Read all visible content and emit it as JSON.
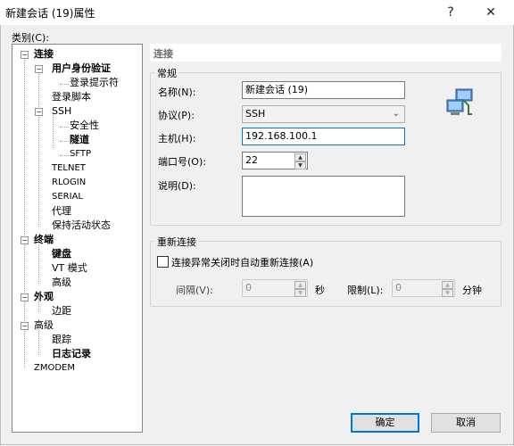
{
  "window": {
    "title": "新建会话 (19)属性",
    "help_glyph": "?",
    "close_glyph": "✕"
  },
  "category_label": "类别(C):",
  "tree": {
    "n0": "连接",
    "n1": "用户身份验证",
    "n2": "登录提示符",
    "n3": "登录脚本",
    "n4": "SSH",
    "n5": "安全性",
    "n6": "隧道",
    "n7": "SFTP",
    "n8": "TELNET",
    "n9": "RLOGIN",
    "n10": "SERIAL",
    "n11": "代理",
    "n12": "保持活动状态",
    "n13": "终端",
    "n14": "键盘",
    "n15": "VT 模式",
    "n16": "高级",
    "n17": "外观",
    "n18": "边距",
    "n19": "高级",
    "n20": "跟踪",
    "n21": "日志记录",
    "n22": "ZMODEM"
  },
  "section_title": "连接",
  "general": {
    "title": "常规",
    "name_label": "名称(N):",
    "name_value": "新建会话 (19)",
    "protocol_label": "协议(P):",
    "protocol_value": "SSH",
    "host_label": "主机(H):",
    "host_value": "192.168.100.1",
    "port_label": "端口号(O):",
    "port_value": "22",
    "desc_label": "说明(D):",
    "desc_value": ""
  },
  "reconnect": {
    "title": "重新连接",
    "checkbox_label": "连接异常关闭时自动重新连接(A)",
    "checked": false,
    "interval_label": "间隔(V):",
    "interval_value": "0",
    "seconds_unit": "秒",
    "limit_label": "限制(L):",
    "limit_value": "0",
    "minutes_unit": "分钟"
  },
  "buttons": {
    "ok": "确定",
    "cancel": "取消"
  },
  "icons": {
    "network": "network-computers-icon"
  }
}
